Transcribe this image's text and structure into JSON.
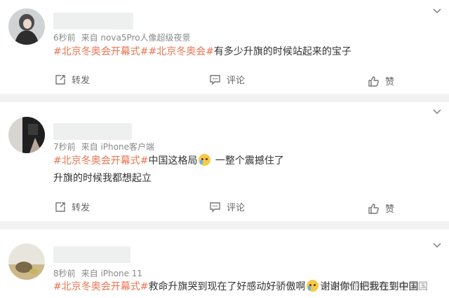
{
  "colors": {
    "tag": "#eb7350",
    "meta": "#8a8a8a",
    "separator": "#f2f2f2"
  },
  "actions": {
    "repost": "转发",
    "comment": "评论",
    "like": "赞"
  },
  "posts": [
    {
      "meta_time": "6秒前",
      "meta_source": "来自 nova5Pro人像超级夜景",
      "lines": [
        {
          "tag": "#北京冬奥会开幕式##北京冬奥会#",
          "text": "有多少升旗的时候站起来的宝子"
        }
      ]
    },
    {
      "meta_time": "7秒前",
      "meta_source": "来自 iPhone客户端",
      "lines": [
        {
          "tag": "#北京冬奥会开幕式#",
          "text": "中国这格局",
          "emoji": "crying-face-emoji",
          "text_after": " 一整个震撼住了"
        },
        {
          "tag": "",
          "text": "升旗的时候我都想起立"
        }
      ]
    },
    {
      "meta_time": "8秒前",
      "meta_source": "来自 iPhone 11",
      "lines": [
        {
          "tag": "#北京冬奥会开幕式#",
          "text": "救命升旗哭到现在了好感动好骄傲啊",
          "emoji": "crying-face-emoji",
          "text_after": "谢谢你们把我在到中国"
        }
      ],
      "overlap_text": "谢谢你们把我生在中国"
    }
  ]
}
